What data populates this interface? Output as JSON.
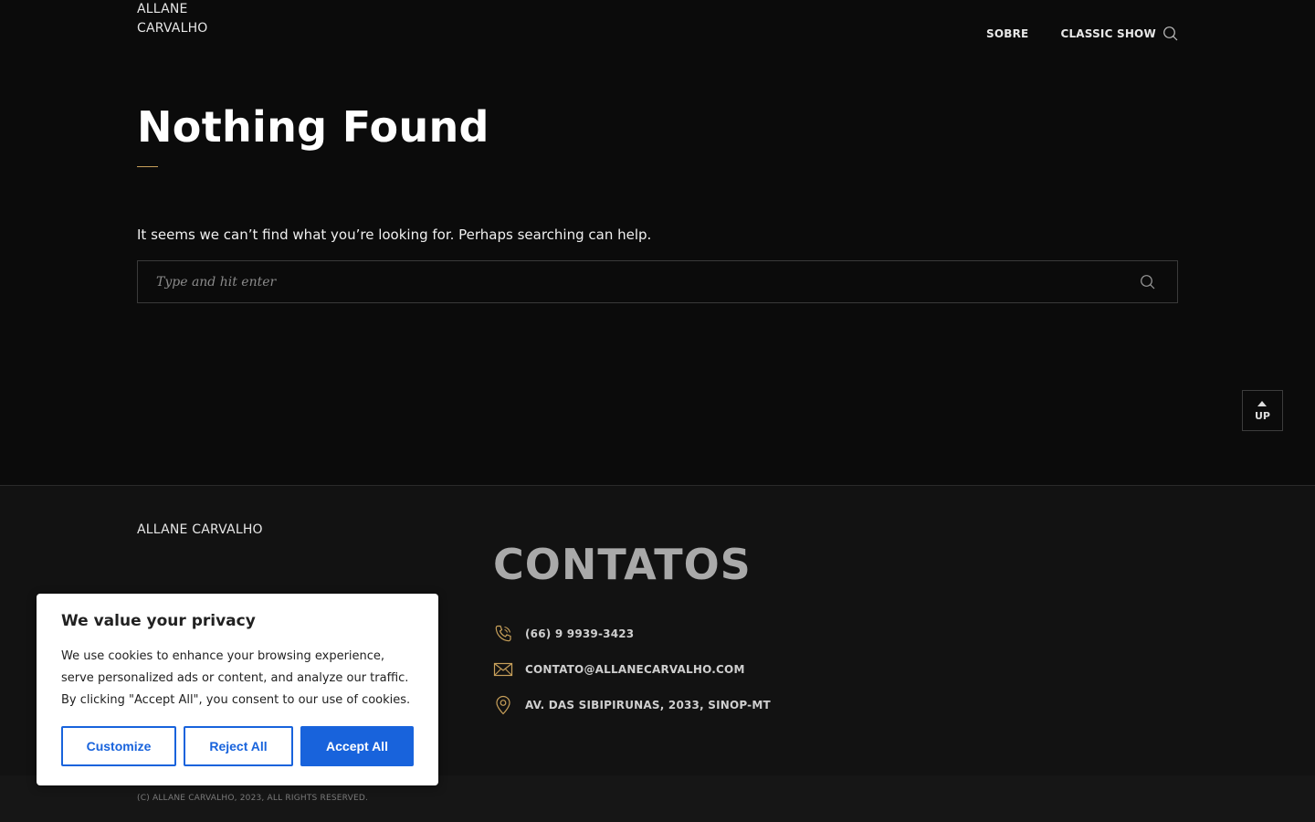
{
  "header": {
    "logo": "ALLANE CARVALHO",
    "nav": [
      {
        "label": "SOBRE"
      },
      {
        "label": "CLASSIC SHOW"
      }
    ],
    "search_icon": "search-icon"
  },
  "main": {
    "title": "Nothing Found",
    "message": "It seems we can’t find what you’re looking for. Perhaps searching can help.",
    "search": {
      "placeholder": "Type and hit enter",
      "value": ""
    }
  },
  "up_button": {
    "label": "UP"
  },
  "footer": {
    "brand": "ALLANE CARVALHO",
    "contacts_title": "CONTATOS",
    "contacts": [
      {
        "icon": "phone-icon",
        "text": "(66) 9 9939-3423"
      },
      {
        "icon": "mail-icon",
        "text": "CONTATO@ALLANECARVALHO.COM"
      },
      {
        "icon": "location-pin-icon",
        "text": "AV. DAS SIBIPIRUNAS, 2033, SINOP-MT"
      }
    ],
    "copyright": "(C) ALLANE CARVALHO, 2023, ALL RIGHTS RESERVED."
  },
  "cookie_banner": {
    "title": "We value your privacy",
    "text": "We use cookies to enhance your browsing experience, serve personalized ads or content, and analyze our traffic. By clicking \"Accept All\", you consent to our use of cookies.",
    "customize_label": "Customize",
    "reject_label": "Reject All",
    "accept_label": "Accept All"
  },
  "colors": {
    "background": "#0b0b0b",
    "footer_background": "#121212",
    "accent": "#c8a05a",
    "cookie_button_blue": "#1863dc"
  }
}
